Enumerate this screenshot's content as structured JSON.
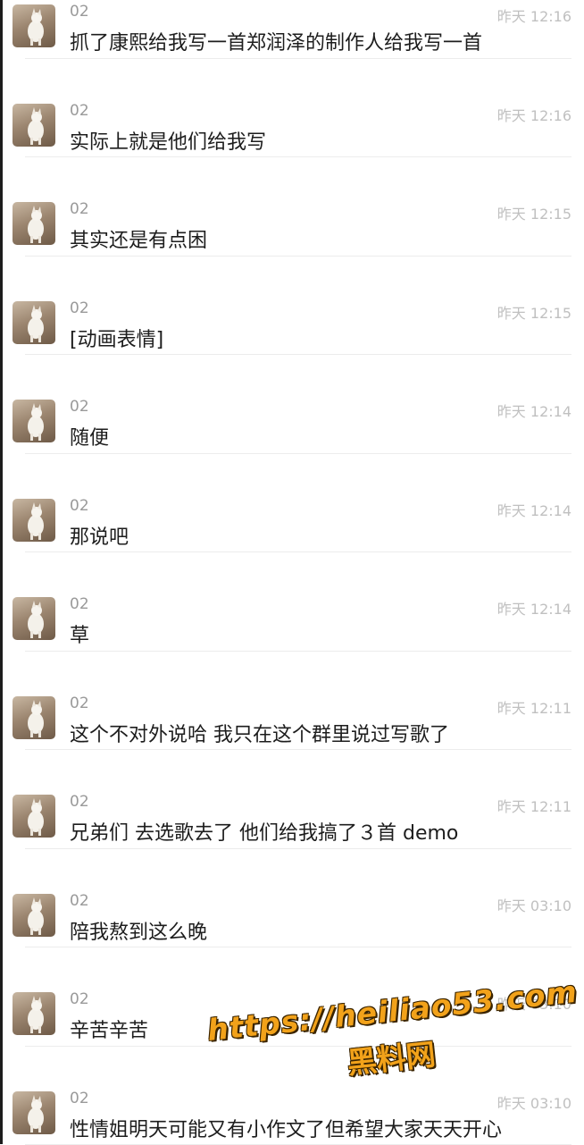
{
  "messages": [
    {
      "name": "02",
      "time": "昨天 12:16",
      "text": "抓了康熙给我写一首郑润泽的制作人给我写一首"
    },
    {
      "name": "02",
      "time": "昨天 12:16",
      "text": "实际上就是他们给我写"
    },
    {
      "name": "02",
      "time": "昨天 12:15",
      "text": "其实还是有点困"
    },
    {
      "name": "02",
      "time": "昨天 12:15",
      "text": "[动画表情]"
    },
    {
      "name": "02",
      "time": "昨天 12:14",
      "text": "随便"
    },
    {
      "name": "02",
      "time": "昨天 12:14",
      "text": "那说吧"
    },
    {
      "name": "02",
      "time": "昨天 12:14",
      "text": "草"
    },
    {
      "name": "02",
      "time": "昨天 12:11",
      "text": "这个不对外说哈 我只在这个群里说过写歌了"
    },
    {
      "name": "02",
      "time": "昨天 12:11",
      "text": "兄弟们 去选歌去了 他们给我搞了３首 demo"
    },
    {
      "name": "02",
      "time": "昨天 03:10",
      "text": "陪我熬到这么晚"
    },
    {
      "name": "02",
      "time": "昨天 03:10",
      "text": "辛苦辛苦"
    },
    {
      "name": "02",
      "time": "昨天 03:10",
      "text": "性情姐明天可能又有小作文了但希望大家天天开心"
    }
  ],
  "avatar_icon": "dog-avatar-icon",
  "watermark": {
    "url": "https://heiliao53.com",
    "name": "黑料网",
    "color": "#f2a21a"
  },
  "colors": {
    "name": "#9a9a9a",
    "time": "#c0c0c0",
    "text": "#1d1d1d",
    "divider": "#ececec"
  }
}
